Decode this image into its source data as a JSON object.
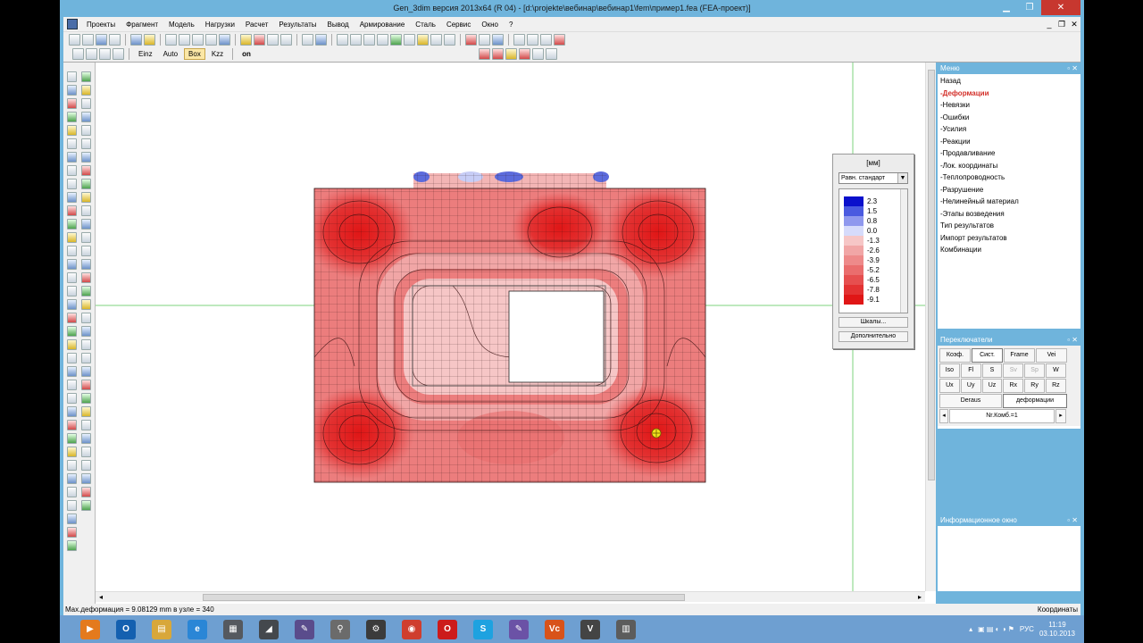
{
  "window": {
    "title": "Gen_3dim версия 2013x64 (R 04) - [d:\\projekte\\вебинар\\вебинар1\\fem\\пример1.fea  (FEA-проект)]"
  },
  "menubar": [
    "Проекты",
    "Фрагмент",
    "Модель",
    "Нагрузки",
    "Расчет",
    "Результаты",
    "Вывод",
    "Армирование",
    "Сталь",
    "Сервис",
    "Окно",
    "?"
  ],
  "toolbar2": {
    "btn_einz": "Einz",
    "btn_auto": "Auto",
    "btn_box": "Box",
    "btn_kzz": "Kzz",
    "btn_on": "on"
  },
  "legend": {
    "unit": "[мм]",
    "mode": "Равн. стандарт",
    "levels": [
      {
        "value": "2.3",
        "color": "#0a10cc"
      },
      {
        "value": "1.5",
        "color": "#4a5ae0"
      },
      {
        "value": "0.8",
        "color": "#8f98ee"
      },
      {
        "value": "0.0",
        "color": "#d6dbfb"
      },
      {
        "value": "-1.3",
        "color": "#f6c6c6"
      },
      {
        "value": "-2.6",
        "color": "#f1a6a6"
      },
      {
        "value": "-3.9",
        "color": "#ee8a8a"
      },
      {
        "value": "-5.2",
        "color": "#ea6d6d"
      },
      {
        "value": "-6.5",
        "color": "#e64f4f"
      },
      {
        "value": "-7.8",
        "color": "#e33232"
      },
      {
        "value": "-9.1",
        "color": "#e01616"
      }
    ],
    "btn_scales": "Шкалы...",
    "btn_more": "Дополнительно"
  },
  "menu_panel": {
    "title": "Меню",
    "items": [
      {
        "label": "Назад"
      },
      {
        "label": "-Деформации",
        "active": true
      },
      {
        "label": "-Невязки"
      },
      {
        "label": "-Ошибки"
      },
      {
        "label": "-Усилия"
      },
      {
        "label": "-Реакции"
      },
      {
        "label": "-Продавливание"
      },
      {
        "label": "-Лок. координаты"
      },
      {
        "label": "-Теплопроводность"
      },
      {
        "label": "-Разрушение"
      },
      {
        "label": "-Нелинейный материал"
      },
      {
        "label": "-Этапы возведения"
      },
      {
        "label": "Тип результатов"
      },
      {
        "label": "Импорт результатов"
      },
      {
        "label": "Комбинации"
      }
    ]
  },
  "switch_panel": {
    "title": "Переключатели",
    "row1": [
      "Коэф.",
      "Сист.",
      "Frame",
      "Vei"
    ],
    "row2": [
      "Iso",
      "Fl",
      "S",
      "Sv",
      "Sp",
      "W"
    ],
    "row3": [
      "Ux",
      "Uy",
      "Uz",
      "Rx",
      "Ry",
      "Rz"
    ],
    "tab_left": "Deraus",
    "tab_right": "деформации",
    "combo": "Nr.Комб.=1"
  },
  "info_panel": {
    "title": "Информационное окно"
  },
  "statusbar": {
    "left": "Max.деформация  = 9.08129 mm  в узле  = 340",
    "right": "Координаты"
  },
  "taskbar": {
    "lang": "РУС",
    "time": "11:19",
    "date": "03.10.2013",
    "apps": [
      {
        "name": "media-player",
        "color": "#e47a1d",
        "glyph": "▶"
      },
      {
        "name": "outlook",
        "color": "#1460b0",
        "glyph": "O"
      },
      {
        "name": "explorer",
        "color": "#d8a73a",
        "glyph": "▤"
      },
      {
        "name": "internet-explorer",
        "color": "#2a86d6",
        "glyph": "e"
      },
      {
        "name": "app-slab",
        "color": "#55595f",
        "glyph": "▦"
      },
      {
        "name": "app-frame",
        "color": "#44484d",
        "glyph": "◢"
      },
      {
        "name": "app-beam",
        "color": "#5a4c8c",
        "glyph": "✎"
      },
      {
        "name": "app-search",
        "color": "#6b6b6b",
        "glyph": "⚲"
      },
      {
        "name": "app-grid",
        "color": "#3b3b3b",
        "glyph": "⚙"
      },
      {
        "name": "chrome",
        "color": "#cf3e2e",
        "glyph": "◉"
      },
      {
        "name": "opera",
        "color": "#cc1b1b",
        "glyph": "O"
      },
      {
        "name": "skype",
        "color": "#1ea2e0",
        "glyph": "S"
      },
      {
        "name": "app-pen",
        "color": "#6b52a6",
        "glyph": "✎"
      },
      {
        "name": "app-vc",
        "color": "#d8531a",
        "glyph": "Vc"
      },
      {
        "name": "app-v",
        "color": "#444",
        "glyph": "V"
      },
      {
        "name": "app-doc",
        "color": "#5c5c5c",
        "glyph": "▥"
      }
    ]
  }
}
